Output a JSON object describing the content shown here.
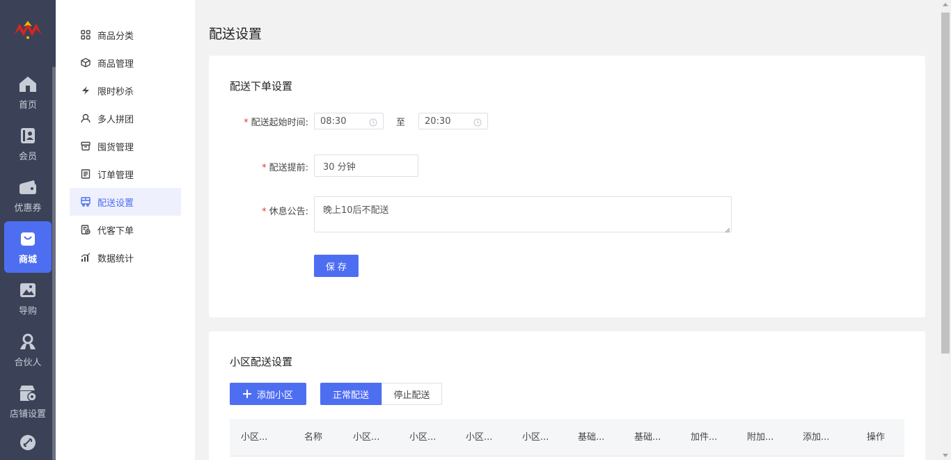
{
  "rail": {
    "items": [
      {
        "label": "首页",
        "icon": "home-icon"
      },
      {
        "label": "会员",
        "icon": "member-icon"
      },
      {
        "label": "优惠券",
        "icon": "coupon-icon"
      },
      {
        "label": "商城",
        "icon": "shop-bag-icon",
        "active": true
      },
      {
        "label": "导购",
        "icon": "guide-image-icon"
      },
      {
        "label": "合伙人",
        "icon": "partner-icon"
      },
      {
        "label": "店铺设置",
        "icon": "store-settings-icon"
      },
      {
        "label": "",
        "icon": "link-icon"
      }
    ]
  },
  "submenu": {
    "items": [
      {
        "label": "商品分类",
        "icon": "grid-icon"
      },
      {
        "label": "商品管理",
        "icon": "box-icon"
      },
      {
        "label": "限时秒杀",
        "icon": "flash-icon"
      },
      {
        "label": "多人拼团",
        "icon": "group-icon"
      },
      {
        "label": "囤货管理",
        "icon": "stock-icon"
      },
      {
        "label": "订单管理",
        "icon": "order-icon"
      },
      {
        "label": "配送设置",
        "icon": "delivery-icon",
        "active": true
      },
      {
        "label": "代客下单",
        "icon": "proxy-order-icon"
      },
      {
        "label": "数据统计",
        "icon": "chart-icon"
      }
    ]
  },
  "page": {
    "title": "配送设置"
  },
  "order_settings": {
    "title": "配送下单设置",
    "start_time_label": "配送起始时间:",
    "start_time": "08:30",
    "to_label": "至",
    "end_time": "20:30",
    "advance_label": "配送提前:",
    "advance_value": "30 分钟",
    "notice_label": "休息公告:",
    "notice_value": "晚上10后不配送",
    "save_label": "保 存"
  },
  "community_settings": {
    "title": "小区配送设置",
    "add_label": "添加小区",
    "tab_normal": "正常配送",
    "tab_stop": "停止配送",
    "columns": [
      "小区...",
      "名称",
      "小区...",
      "小区...",
      "小区...",
      "小区...",
      "基础...",
      "基础...",
      "加件...",
      "附加...",
      "添加...",
      "操作"
    ]
  },
  "colors": {
    "accent": "#4e6ef2",
    "rail_bg": "#3b4257",
    "required": "#e53935"
  }
}
